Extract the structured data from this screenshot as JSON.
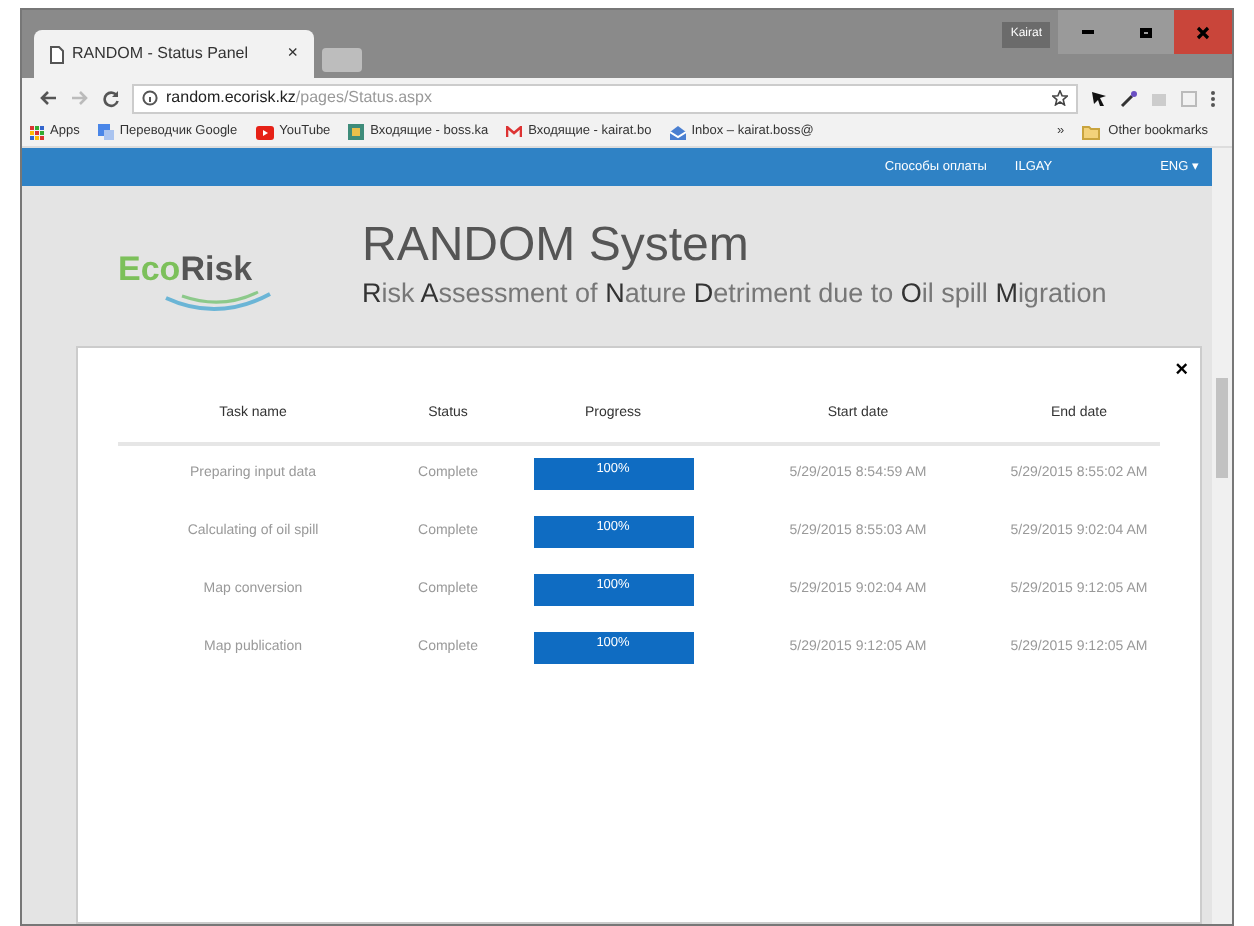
{
  "window": {
    "user": "Kairat",
    "tab": {
      "title": "RANDOM - Status Panel",
      "close": "×"
    }
  },
  "address": {
    "host": "random.ecorisk.kz",
    "path": "/pages/Status.aspx"
  },
  "bookmarks": [
    {
      "kind": "apps",
      "label": "Apps"
    },
    {
      "kind": "translate",
      "label": "Переводчик Google"
    },
    {
      "kind": "youtube",
      "label": "YouTube"
    },
    {
      "kind": "mailbox",
      "label": "Входящие - boss.ka"
    },
    {
      "kind": "gmail",
      "label": "Входящие - kairat.bo"
    },
    {
      "kind": "inbox",
      "label": "Inbox – kairat.boss@"
    }
  ],
  "bookmarks_more": "»",
  "other_bookmarks": "Other bookmarks",
  "nav": {
    "items": [
      "Способы оплаты",
      "ILGAY"
    ],
    "language": "ENG ▾"
  },
  "logo": {
    "text": "EcoRisk"
  },
  "header": {
    "title": "RANDOM System",
    "subtitle": "**R**isk **A**ssessment of **N**ature **D**etriment due to **O**il spill **M**igration"
  },
  "panel": {
    "close": "×",
    "columns": [
      "Task name",
      "Status",
      "Progress",
      "Start date",
      "End date"
    ],
    "rows": [
      {
        "task": "Preparing input data",
        "status": "Complete",
        "level": 1,
        "progress": "100%",
        "start": "5/29/2015 8:54:59 AM",
        "end": "5/29/2015 8:55:02 AM"
      },
      {
        "task": "Calculating of oil spill",
        "status": "Complete",
        "level": 1,
        "progress": "100%",
        "start": "5/29/2015 8:55:03 AM",
        "end": "5/29/2015 9:02:04 AM"
      },
      {
        "task": "Map conversion",
        "status": "Complete",
        "level": 1,
        "progress": "100%",
        "start": "5/29/2015 9:02:04 AM",
        "end": "5/29/2015 9:12:05 AM"
      },
      {
        "task": "Map publication",
        "status": "Complete",
        "level": 1,
        "progress": "100%",
        "start": "5/29/2015 9:12:05 AM",
        "end": "5/29/2015 9:12:05 AM"
      }
    ]
  }
}
